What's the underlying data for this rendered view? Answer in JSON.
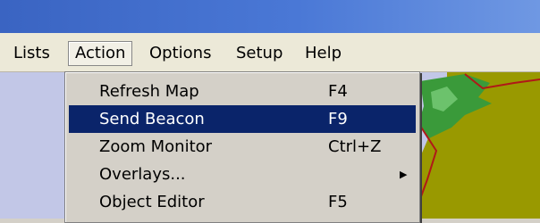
{
  "menubar": {
    "items": [
      {
        "label": "Lists"
      },
      {
        "label": "Action"
      },
      {
        "label": "Options"
      },
      {
        "label": "Setup"
      },
      {
        "label": "Help"
      }
    ]
  },
  "action_menu": {
    "items": [
      {
        "label": "Refresh Map",
        "shortcut": "F4",
        "highlighted": false
      },
      {
        "label": "Send Beacon",
        "shortcut": "F9",
        "highlighted": true
      },
      {
        "label": "Zoom Monitor",
        "shortcut": "Ctrl+Z",
        "highlighted": false
      },
      {
        "label": "Overlays...",
        "shortcut": "",
        "submenu_icon": "submenu-arrow-icon",
        "highlighted": false
      },
      {
        "label": "Object Editor",
        "shortcut": "F5",
        "highlighted": false
      }
    ]
  },
  "colors": {
    "title_bar": "#3a64c2",
    "menu_highlight": "#0a246a",
    "map_water": "#c2c7e7",
    "map_land": "#999900",
    "map_vegetation": "#3a9a3a",
    "map_border": "#b01818"
  }
}
